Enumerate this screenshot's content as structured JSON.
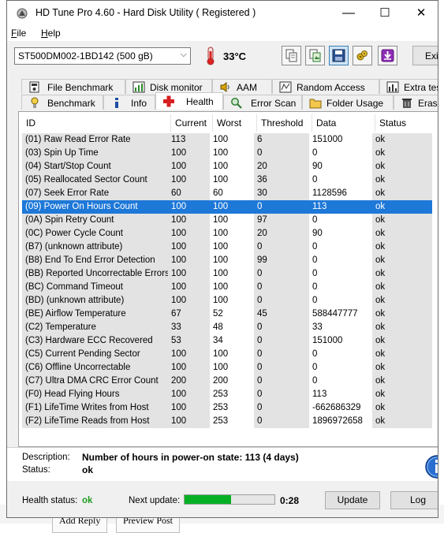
{
  "window": {
    "title": "HD Tune Pro 4.60 - Hard Disk Utility ( Registered )",
    "minimize": "—",
    "maximize": "☐",
    "close": "✕"
  },
  "menu": {
    "items": [
      {
        "label": "File",
        "underline": "F",
        "rest": "ile"
      },
      {
        "label": "Help",
        "underline": "H",
        "rest": "elp"
      }
    ]
  },
  "toolbar": {
    "drive": "ST500DM002-1BD142 (500 gB)",
    "temperature": "33°C",
    "exit_label": "Exit",
    "buttons": [
      "copy-text-icon",
      "copy-screenshot-icon",
      "save-icon",
      "options-icon",
      "download-icon"
    ]
  },
  "tabs": {
    "top": [
      {
        "label": "File Benchmark",
        "icon": "file-benchmark-icon"
      },
      {
        "label": "Disk monitor",
        "icon": "disk-monitor-icon"
      },
      {
        "label": "AAM",
        "icon": "speaker-icon"
      },
      {
        "label": "Random Access",
        "icon": "random-access-icon"
      },
      {
        "label": "Extra tests",
        "icon": "extra-tests-icon"
      }
    ],
    "bottom": [
      {
        "label": "Benchmark",
        "icon": "benchmark-icon"
      },
      {
        "label": "Info",
        "icon": "info-tab-icon"
      },
      {
        "label": "Health",
        "icon": "health-cross-icon"
      },
      {
        "label": "Error Scan",
        "icon": "magnifier-icon"
      },
      {
        "label": "Folder Usage",
        "icon": "folder-icon"
      },
      {
        "label": "Erase",
        "icon": "trash-icon"
      }
    ],
    "selected": "Health"
  },
  "table": {
    "headers": [
      "ID",
      "Current",
      "Worst",
      "Threshold",
      "Data",
      "Status"
    ],
    "selected_row": 5,
    "rows": [
      [
        "(01) Raw Read Error Rate",
        "113",
        "100",
        "6",
        "151000",
        "ok"
      ],
      [
        "(03) Spin Up Time",
        "100",
        "100",
        "0",
        "0",
        "ok"
      ],
      [
        "(04) Start/Stop Count",
        "100",
        "100",
        "20",
        "90",
        "ok"
      ],
      [
        "(05) Reallocated Sector Count",
        "100",
        "100",
        "36",
        "0",
        "ok"
      ],
      [
        "(07) Seek Error Rate",
        "60",
        "60",
        "30",
        "1128596",
        "ok"
      ],
      [
        "(09) Power On Hours Count",
        "100",
        "100",
        "0",
        "113",
        "ok"
      ],
      [
        "(0A) Spin Retry Count",
        "100",
        "100",
        "97",
        "0",
        "ok"
      ],
      [
        "(0C) Power Cycle Count",
        "100",
        "100",
        "20",
        "90",
        "ok"
      ],
      [
        "(B7) (unknown attribute)",
        "100",
        "100",
        "0",
        "0",
        "ok"
      ],
      [
        "(B8) End To End Error Detection",
        "100",
        "100",
        "99",
        "0",
        "ok"
      ],
      [
        "(BB) Reported Uncorrectable Errors",
        "100",
        "100",
        "0",
        "0",
        "ok"
      ],
      [
        "(BC) Command Timeout",
        "100",
        "100",
        "0",
        "0",
        "ok"
      ],
      [
        "(BD) (unknown attribute)",
        "100",
        "100",
        "0",
        "0",
        "ok"
      ],
      [
        "(BE) Airflow Temperature",
        "67",
        "52",
        "45",
        "588447777",
        "ok"
      ],
      [
        "(C2) Temperature",
        "33",
        "48",
        "0",
        "33",
        "ok"
      ],
      [
        "(C3) Hardware ECC Recovered",
        "53",
        "34",
        "0",
        "151000",
        "ok"
      ],
      [
        "(C5) Current Pending Sector",
        "100",
        "100",
        "0",
        "0",
        "ok"
      ],
      [
        "(C6) Offline Uncorrectable",
        "100",
        "100",
        "0",
        "0",
        "ok"
      ],
      [
        "(C7) Ultra DMA CRC Error Count",
        "200",
        "200",
        "0",
        "0",
        "ok"
      ],
      [
        "(F0) Head Flying Hours",
        "100",
        "253",
        "0",
        "113",
        "ok"
      ],
      [
        "(F1) LifeTime Writes from Host",
        "100",
        "253",
        "0",
        "-662686329",
        "ok"
      ],
      [
        "(F2) LifeTime Reads from Host",
        "100",
        "253",
        "0",
        "1896972658",
        "ok"
      ]
    ]
  },
  "description": {
    "desc_label": "Description:",
    "desc_value": "Number of hours in power-on state: 113 (4 days)",
    "status_label": "Status:",
    "status_value": "ok"
  },
  "footer": {
    "health_label": "Health status:",
    "health_value": "ok",
    "next_update_label": "Next update:",
    "progress_fraction": 0.52,
    "countdown": "0:28",
    "update_label": "Update",
    "log_label": "Log"
  },
  "background": {
    "reply_label": "Add Reply",
    "preview_label": "Preview Post"
  }
}
